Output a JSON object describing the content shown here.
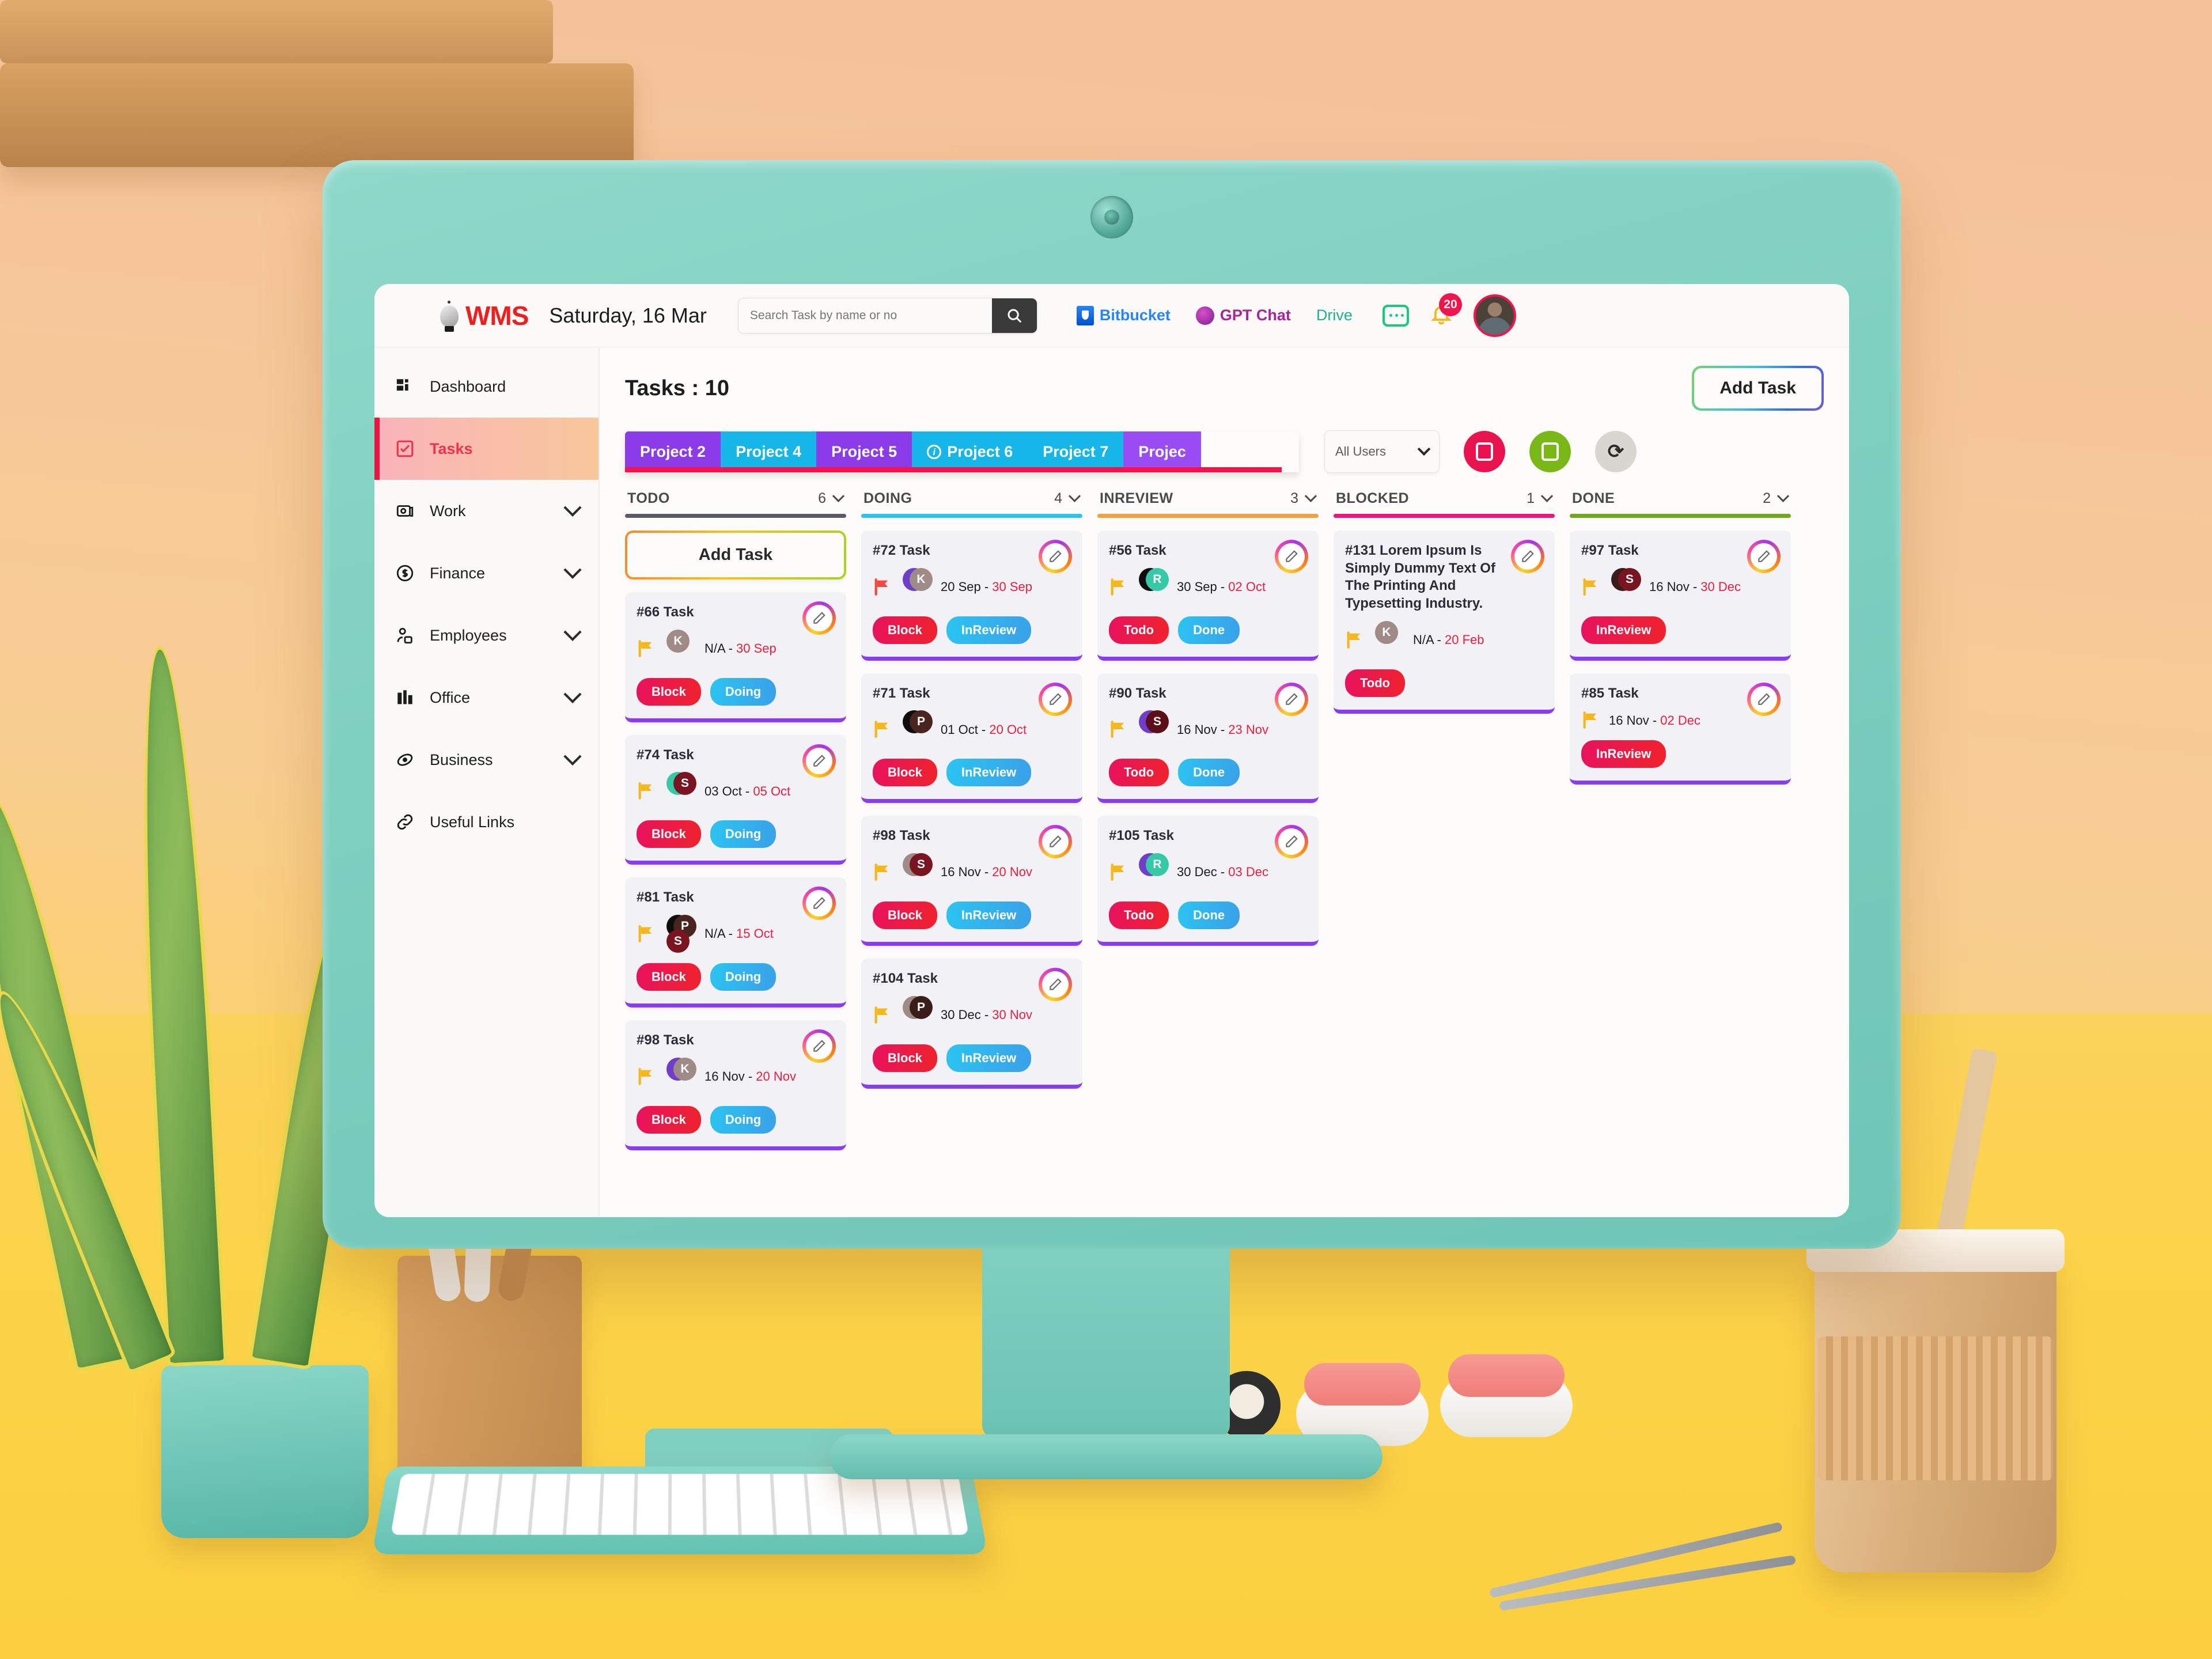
{
  "header": {
    "brand": "WMS",
    "date": "Saturday, 16 Mar",
    "search_placeholder": "Search Task by name or no",
    "links": [
      {
        "label": "Bitbucket",
        "icon": "bitbucket-icon"
      },
      {
        "label": "GPT Chat",
        "icon": "gpt-chat-icon"
      },
      {
        "label": "Drive",
        "icon": "drive-icon"
      }
    ],
    "notification_count": "20"
  },
  "sidebar": {
    "items": [
      {
        "label": "Dashboard",
        "icon": "dashboard-icon",
        "active": false,
        "expandable": false
      },
      {
        "label": "Tasks",
        "icon": "tasks-icon",
        "active": true,
        "expandable": false
      },
      {
        "label": "Work",
        "icon": "work-icon",
        "active": false,
        "expandable": true
      },
      {
        "label": "Finance",
        "icon": "finance-icon",
        "active": false,
        "expandable": true
      },
      {
        "label": "Employees",
        "icon": "employees-icon",
        "active": false,
        "expandable": true
      },
      {
        "label": "Office",
        "icon": "office-icon",
        "active": false,
        "expandable": true
      },
      {
        "label": "Business",
        "icon": "business-icon",
        "active": false,
        "expandable": true
      },
      {
        "label": "Useful Links",
        "icon": "link-icon",
        "active": false,
        "expandable": false
      }
    ]
  },
  "main": {
    "title": "Tasks : 10",
    "add_task_label": "Add Task",
    "tabs": [
      {
        "label": "Project 2",
        "color": "#8b3ce8",
        "info": false
      },
      {
        "label": "Project 4",
        "color": "#17b6e8",
        "info": false
      },
      {
        "label": "Project 5",
        "color": "#8b3ce8",
        "info": false
      },
      {
        "label": "Project 6",
        "color": "#17b6e8",
        "info": true
      },
      {
        "label": "Project 7",
        "color": "#17b6e8",
        "info": false
      },
      {
        "label": "Projec",
        "color": "#9a4cf5",
        "info": false
      }
    ],
    "user_filter": "All Users",
    "toolbar_buttons": [
      {
        "name": "export-red-button",
        "color": "#e8134f"
      },
      {
        "name": "export-green-button",
        "color": "#7ab817"
      },
      {
        "name": "refresh-button",
        "color": "#d9d6d2"
      }
    ]
  },
  "board": {
    "columns": [
      {
        "name": "TODO",
        "count": "6",
        "rule_color": "#5b5b68",
        "show_add_task": true,
        "add_task_label": "Add Task",
        "cards": [
          {
            "title": "#66 Task",
            "flag": "amber",
            "avatars": [
              {
                "letter": "K",
                "color": "#a08a86"
              }
            ],
            "dates_from": "N/A - ",
            "dates_to": "30 Sep",
            "actions": [
              {
                "label": "Block",
                "style": "red"
              },
              {
                "label": "Doing",
                "style": "blue"
              }
            ]
          },
          {
            "title": "#74 Task",
            "flag": "amber",
            "avatars": [
              {
                "letter": "R",
                "color": "#35c9a8"
              },
              {
                "letter": "S",
                "color": "#7a1420"
              }
            ],
            "dates_from": "03 Oct - ",
            "dates_to": "05 Oct",
            "actions": [
              {
                "label": "Block",
                "style": "red"
              },
              {
                "label": "Doing",
                "style": "blue"
              }
            ]
          },
          {
            "title": "#81 Task",
            "flag": "amber",
            "avatars": [
              {
                "letter": "G",
                "color": "#0d0d0d"
              },
              {
                "letter": "P",
                "color": "#4a2520"
              },
              {
                "letter": "S",
                "color": "#7a1420"
              }
            ],
            "dates_from": "N/A - ",
            "dates_to": "15 Oct",
            "actions": [
              {
                "label": "Block",
                "style": "red"
              },
              {
                "label": "Doing",
                "style": "blue"
              }
            ]
          },
          {
            "title": "#98 Task",
            "flag": "amber",
            "avatars": [
              {
                "letter": "B",
                "color": "#6f3dc9"
              },
              {
                "letter": "K",
                "color": "#a08a86"
              }
            ],
            "dates_from": "16 Nov - ",
            "dates_to": "20 Nov",
            "actions": [
              {
                "label": "Block",
                "style": "red"
              },
              {
                "label": "Doing",
                "style": "blue"
              }
            ]
          }
        ]
      },
      {
        "name": "DOING",
        "count": "4",
        "rule_color": "#2bc4f2",
        "show_add_task": false,
        "cards": [
          {
            "title": "#72 Task",
            "flag": "red",
            "avatars": [
              {
                "letter": "D",
                "color": "#6f3dc9"
              },
              {
                "letter": "K",
                "color": "#a08a86"
              }
            ],
            "dates_from": "20 Sep - ",
            "dates_to": "30 Sep",
            "actions": [
              {
                "label": "Block",
                "style": "red"
              },
              {
                "label": "InReview",
                "style": "blue"
              }
            ]
          },
          {
            "title": "#71 Task",
            "flag": "amber",
            "avatars": [
              {
                "letter": "G",
                "color": "#0d0d0d"
              },
              {
                "letter": "P",
                "color": "#4a2520"
              }
            ],
            "dates_from": "01 Oct - ",
            "dates_to": "20 Oct",
            "actions": [
              {
                "label": "Block",
                "style": "red"
              },
              {
                "label": "InReview",
                "style": "blue"
              }
            ]
          },
          {
            "title": "#98 Task",
            "flag": "amber",
            "avatars": [
              {
                "letter": "K",
                "color": "#a08a86"
              },
              {
                "letter": "S",
                "color": "#7a1420"
              }
            ],
            "dates_from": "16 Nov - ",
            "dates_to": "20 Nov",
            "actions": [
              {
                "label": "Block",
                "style": "red"
              },
              {
                "label": "InReview",
                "style": "blue"
              }
            ]
          },
          {
            "title": "#104 Task",
            "flag": "amber",
            "avatars": [
              {
                "letter": "K",
                "color": "#a08a86"
              },
              {
                "letter": "P",
                "color": "#3a1d18"
              }
            ],
            "dates_from": "30 Dec - ",
            "dates_to": "30 Nov",
            "actions": [
              {
                "label": "Block",
                "style": "red"
              },
              {
                "label": "InReview",
                "style": "blue"
              }
            ]
          }
        ]
      },
      {
        "name": "INREVIEW",
        "count": "3",
        "rule_color": "#f5a03c",
        "show_add_task": false,
        "cards": [
          {
            "title": "#56 Task",
            "flag": "amber",
            "avatars": [
              {
                "letter": "G",
                "color": "#0d0d0d"
              },
              {
                "letter": "R",
                "color": "#35c9a8"
              }
            ],
            "dates_from": "30 Sep - ",
            "dates_to": "02 Oct",
            "actions": [
              {
                "label": "Todo",
                "style": "red"
              },
              {
                "label": "Done",
                "style": "blue"
              }
            ]
          },
          {
            "title": "#90 Task",
            "flag": "amber",
            "avatars": [
              {
                "letter": "B",
                "color": "#6f3dc9"
              },
              {
                "letter": "S",
                "color": "#5c0f19"
              }
            ],
            "dates_from": "16 Nov - ",
            "dates_to": "23 Nov",
            "actions": [
              {
                "label": "Todo",
                "style": "red"
              },
              {
                "label": "Done",
                "style": "blue"
              }
            ]
          },
          {
            "title": "#105 Task",
            "flag": "amber",
            "avatars": [
              {
                "letter": "B",
                "color": "#6f3dc9"
              },
              {
                "letter": "R",
                "color": "#35c9a8"
              }
            ],
            "dates_from": "30 Dec - ",
            "dates_to": "03 Dec",
            "actions": [
              {
                "label": "Todo",
                "style": "red"
              },
              {
                "label": "Done",
                "style": "blue"
              }
            ]
          }
        ]
      },
      {
        "name": "BLOCKED",
        "count": "1",
        "rule_color": "#f0147f",
        "show_add_task": false,
        "cards": [
          {
            "title": "#131 Lorem Ipsum Is Simply Dummy Text Of The Printing And Typesetting Industry.",
            "flag": "amber",
            "avatars": [
              {
                "letter": "K",
                "color": "#a08a86"
              }
            ],
            "dates_from": "N/A - ",
            "dates_to": "20 Feb",
            "actions": [
              {
                "label": "Todo",
                "style": "red"
              }
            ]
          }
        ]
      },
      {
        "name": "DONE",
        "count": "2",
        "rule_color": "#6fa81d",
        "show_add_task": false,
        "cards": [
          {
            "title": "#97 Task",
            "flag": "amber",
            "avatars": [
              {
                "letter": "P",
                "color": "#3a1d18"
              },
              {
                "letter": "S",
                "color": "#7a1420"
              }
            ],
            "dates_from": "16 Nov - ",
            "dates_to": "30 Dec",
            "actions": [
              {
                "label": "InReview",
                "style": "red"
              }
            ]
          },
          {
            "title": "#85 Task",
            "flag": "amber",
            "avatars": [],
            "dates_from": "16 Nov - ",
            "dates_to": "02 Dec",
            "actions": [
              {
                "label": "InReview",
                "style": "red"
              }
            ]
          }
        ]
      }
    ]
  }
}
